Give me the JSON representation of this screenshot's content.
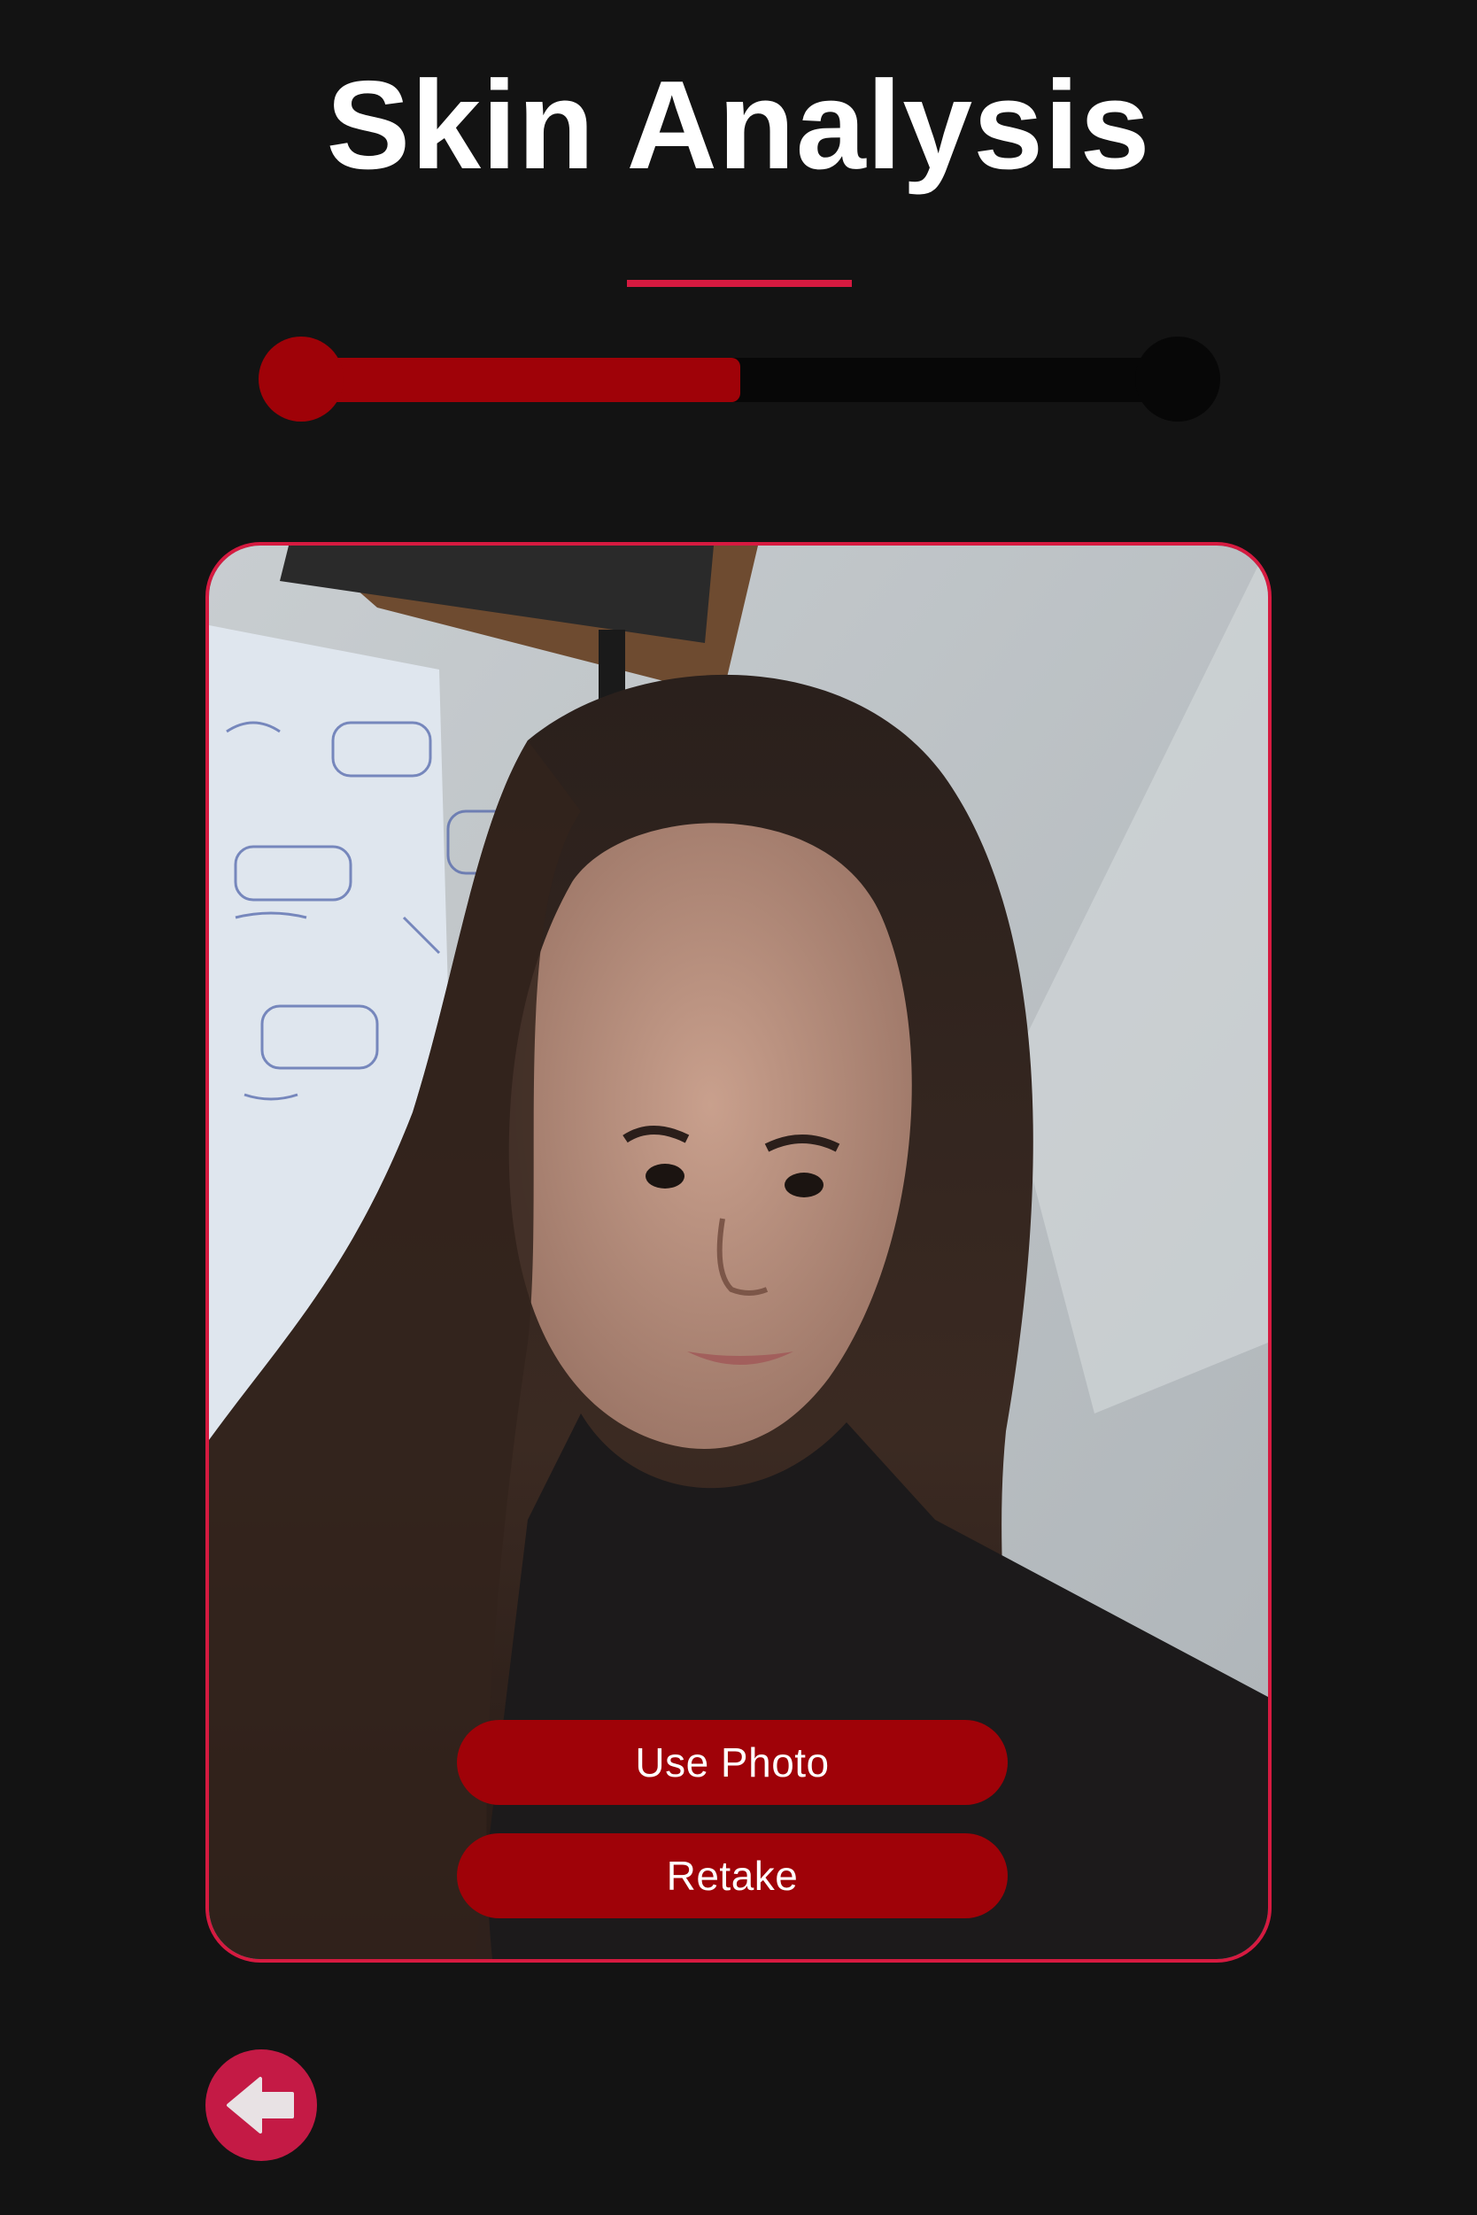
{
  "header": {
    "title": "Skin Analysis"
  },
  "progress": {
    "value": 0.5
  },
  "photo_preview": {
    "use_photo_label": "Use Photo",
    "retake_label": "Retake"
  },
  "navigation": {
    "back_icon": "arrow-left-icon"
  },
  "colors": {
    "background": "#131313",
    "accent": "#d61a40",
    "button": "#9f0208",
    "back_button": "#c41a45",
    "text": "#ffffff"
  }
}
